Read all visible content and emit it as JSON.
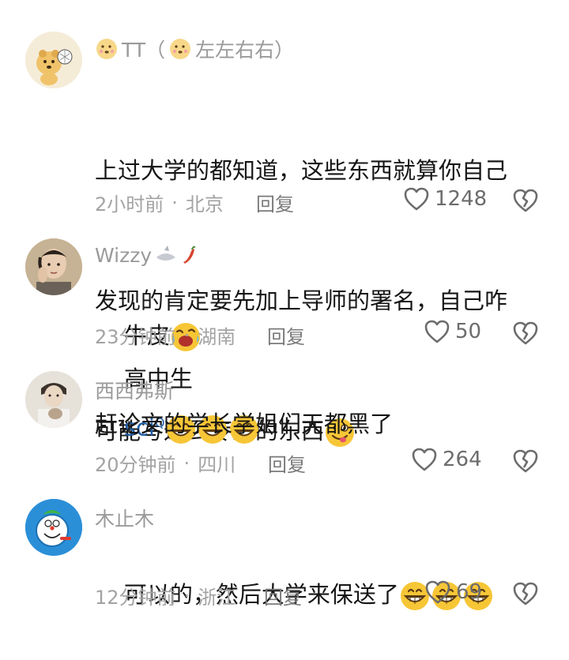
{
  "comments": [
    {
      "username": "TT（",
      "username_suffix": "左左右右）",
      "username_emoji": "kissing-face-emoji",
      "content_lines": [
        "上过大学的都知道，这些东西就算你自己",
        "发现的肯定要先加上导师的署名，自己咋",
        "可能写这么专业的东西"
      ],
      "content_emoji": "yummy-face-emoji",
      "time": "2小时前",
      "location": "北京",
      "reply_label": "回复",
      "likes": "1248"
    },
    {
      "username": "Wizzy",
      "username_emoji": "shark-and-chili-emoji",
      "content_prefix": "牛皮",
      "content_middle": "高中生",
      "content_sci": "sci",
      "content_sup": "Q",
      "content_emoji": "laughing-emoji",
      "time": "23分钟前",
      "location": "湖南",
      "reply_label": "回复",
      "likes": "50"
    },
    {
      "username": "西西弗斯",
      "content": "赶论文的学长学姐们天都黑了",
      "time": "20分钟前",
      "location": "四川",
      "reply_label": "回复",
      "likes": "264"
    },
    {
      "username": "木止木",
      "content": "可以的，然后大学来保送了",
      "content_emoji": "grin-emoji",
      "time": "12分钟前",
      "location": "浙江",
      "reply_label": "回复",
      "likes": "69"
    }
  ],
  "meta_dot": "·",
  "colors": {
    "text": "#161616",
    "meta": "#a3a3a3",
    "sci_link": "#1f5fa8",
    "emoji": "#f7c637"
  }
}
